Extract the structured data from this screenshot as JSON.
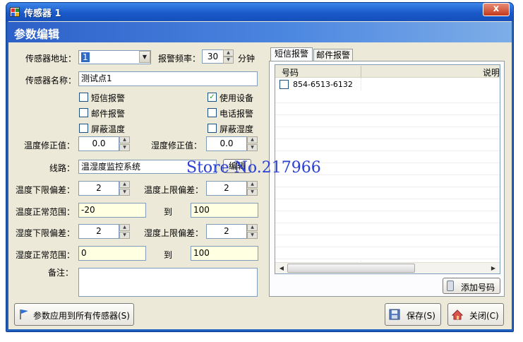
{
  "window": {
    "title": "传感器 1",
    "close_label": "x"
  },
  "header": {
    "title": "参数编辑"
  },
  "form": {
    "address_label": "传感器地址：",
    "address_value": "1",
    "alarm_freq_label": "报警频率：",
    "alarm_freq_value": "30",
    "alarm_freq_unit": "分钟",
    "name_label": "传感器名称：",
    "name_value": "测试点1",
    "checkboxes": [
      {
        "label": "短信报警",
        "checked": false
      },
      {
        "label": "使用设备",
        "checked": true
      },
      {
        "label": "邮件报警",
        "checked": false
      },
      {
        "label": "电话报警",
        "checked": false
      },
      {
        "label": "屏蔽温度",
        "checked": false
      },
      {
        "label": "屏蔽湿度",
        "checked": false
      }
    ],
    "checked_mark": "✓",
    "temp_correction_label": "温度修正值：",
    "temp_correction_value": "0.0",
    "humid_correction_label": "湿度修正值：",
    "humid_correction_value": "0.0",
    "line_label": "线路：",
    "line_value": "温湿度监控系统",
    "edit_button_label": "编辑",
    "temp_low_dev_label": "温度下限偏差：",
    "temp_low_dev_value": "2",
    "temp_high_dev_label": "温度上限偏差：",
    "temp_high_dev_value": "2",
    "temp_range_label": "温度正常范围：",
    "temp_range_min": "-20",
    "to_label_1": "到",
    "temp_range_max": "100",
    "humid_low_dev_label": "湿度下限偏差：",
    "humid_low_dev_value": "2",
    "humid_high_dev_label": "湿度上限偏差：",
    "humid_high_dev_value": "2",
    "humid_range_label": "湿度正常范围：",
    "humid_range_min": "0",
    "to_label_2": "到",
    "humid_range_max": "100",
    "remark_label": "备注：",
    "remark_value": ""
  },
  "tabs": [
    {
      "label": "短信报警",
      "active": true
    },
    {
      "label": "邮件报警",
      "active": false
    }
  ],
  "phone_table": {
    "columns": [
      "号码",
      "说明"
    ],
    "rows": [
      {
        "number": "854-6513-6132",
        "note": ""
      }
    ]
  },
  "buttons": {
    "add_number": "添加号码",
    "apply_all": "参数应用到所有传感器(S)",
    "save": "保存(S)",
    "close": "关闭(C)"
  },
  "watermark": "Store No.217966",
  "icons": {
    "app": "app-icon",
    "dropdown": "dropdown-arrow-icon",
    "spin_up": "spin-up-icon",
    "spin_down": "spin-down-icon",
    "phone": "phone-icon",
    "flag": "flag-icon",
    "save": "floppy-disk-icon",
    "close": "door-exit-icon"
  },
  "colors": {
    "titlebar": "#1a59c9",
    "form_bg": "#ece9d8",
    "highlight_field": "#ffffe1",
    "watermark": "#2a3fd4"
  }
}
